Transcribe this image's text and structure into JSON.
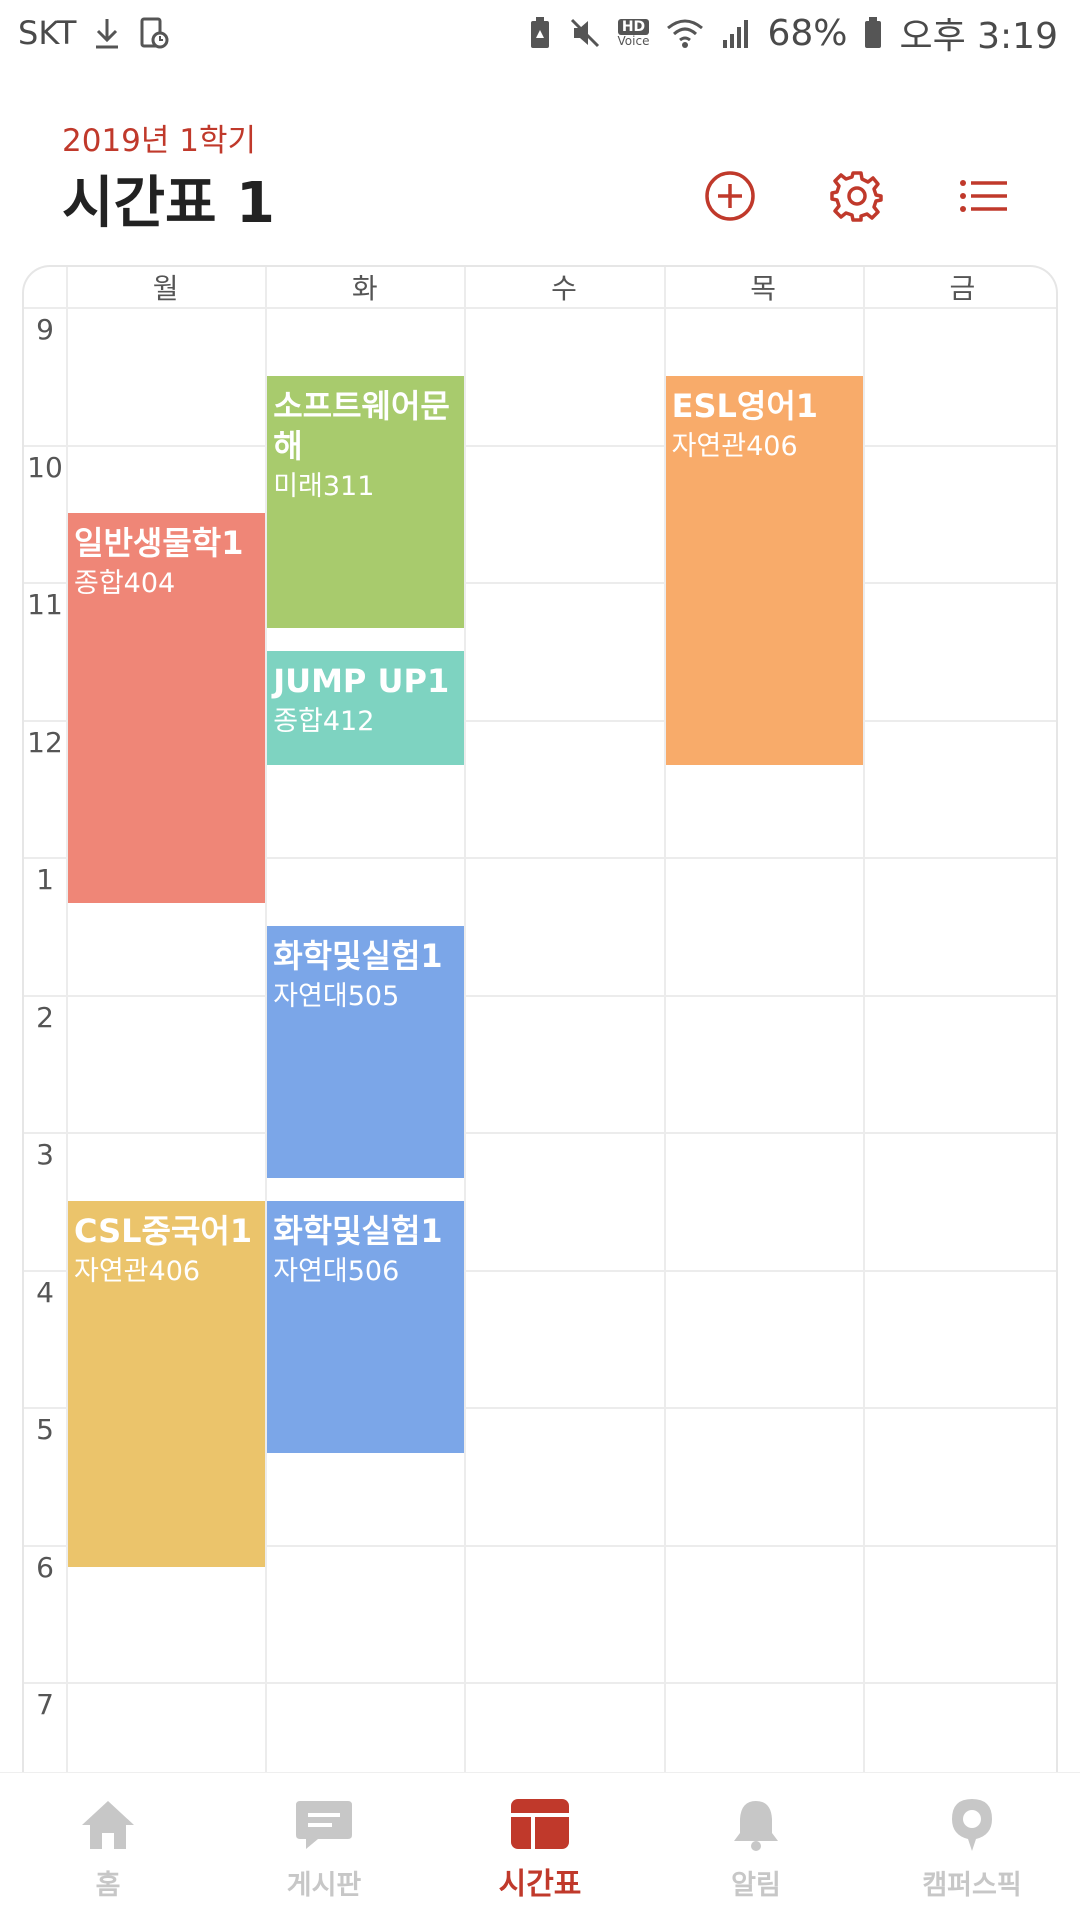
{
  "status_bar": {
    "carrier": "SKT",
    "battery": "68%",
    "time": "오후 3:19",
    "hd_label": "HD",
    "voice_label": "Voice"
  },
  "header": {
    "semester": "2019년 1학기",
    "title": "시간표 1"
  },
  "days": [
    "월",
    "화",
    "수",
    "목",
    "금"
  ],
  "hours": [
    "9",
    "10",
    "11",
    "12",
    "1",
    "2",
    "3",
    "4",
    "5",
    "6",
    "7"
  ],
  "courses": [
    {
      "name": "일반생물학1",
      "room": "종합404",
      "day": "월",
      "start": "10:30",
      "end": "13:20",
      "color": "#ef8677"
    },
    {
      "name": "CSL중국어1",
      "room": "자연관406",
      "day": "월",
      "start": "15:30",
      "end": "18:10",
      "color": "#ebc46b"
    },
    {
      "name": "소프트웨어문해",
      "room": "미래311",
      "day": "화",
      "start": "9:30",
      "end": "11:20",
      "color": "#a8cb6d"
    },
    {
      "name": "JUMP UP1",
      "room": "종합412",
      "day": "화",
      "start": "11:30",
      "end": "12:20",
      "color": "#7ed3c1"
    },
    {
      "name": "화학및실험1",
      "room": "자연대505",
      "day": "화",
      "start": "13:30",
      "end": "15:20",
      "color": "#7ba6e8"
    },
    {
      "name": "화학및실험1",
      "room": "자연대506",
      "day": "화",
      "start": "15:30",
      "end": "17:20",
      "color": "#7ba6e8"
    },
    {
      "name": "ESL영어1",
      "room": "자연관406",
      "day": "목",
      "start": "9:30",
      "end": "12:20",
      "color": "#f8ab6a"
    }
  ],
  "nav": {
    "items": [
      {
        "label": "홈",
        "icon": "home-icon"
      },
      {
        "label": "게시판",
        "icon": "board-icon"
      },
      {
        "label": "시간표",
        "icon": "timetable-icon"
      },
      {
        "label": "알림",
        "icon": "bell-icon"
      },
      {
        "label": "캠퍼스픽",
        "icon": "campuspick-icon"
      }
    ],
    "active_index": 2
  },
  "colors": {
    "accent": "#c0392b",
    "inactive": "#c7c7c7"
  }
}
